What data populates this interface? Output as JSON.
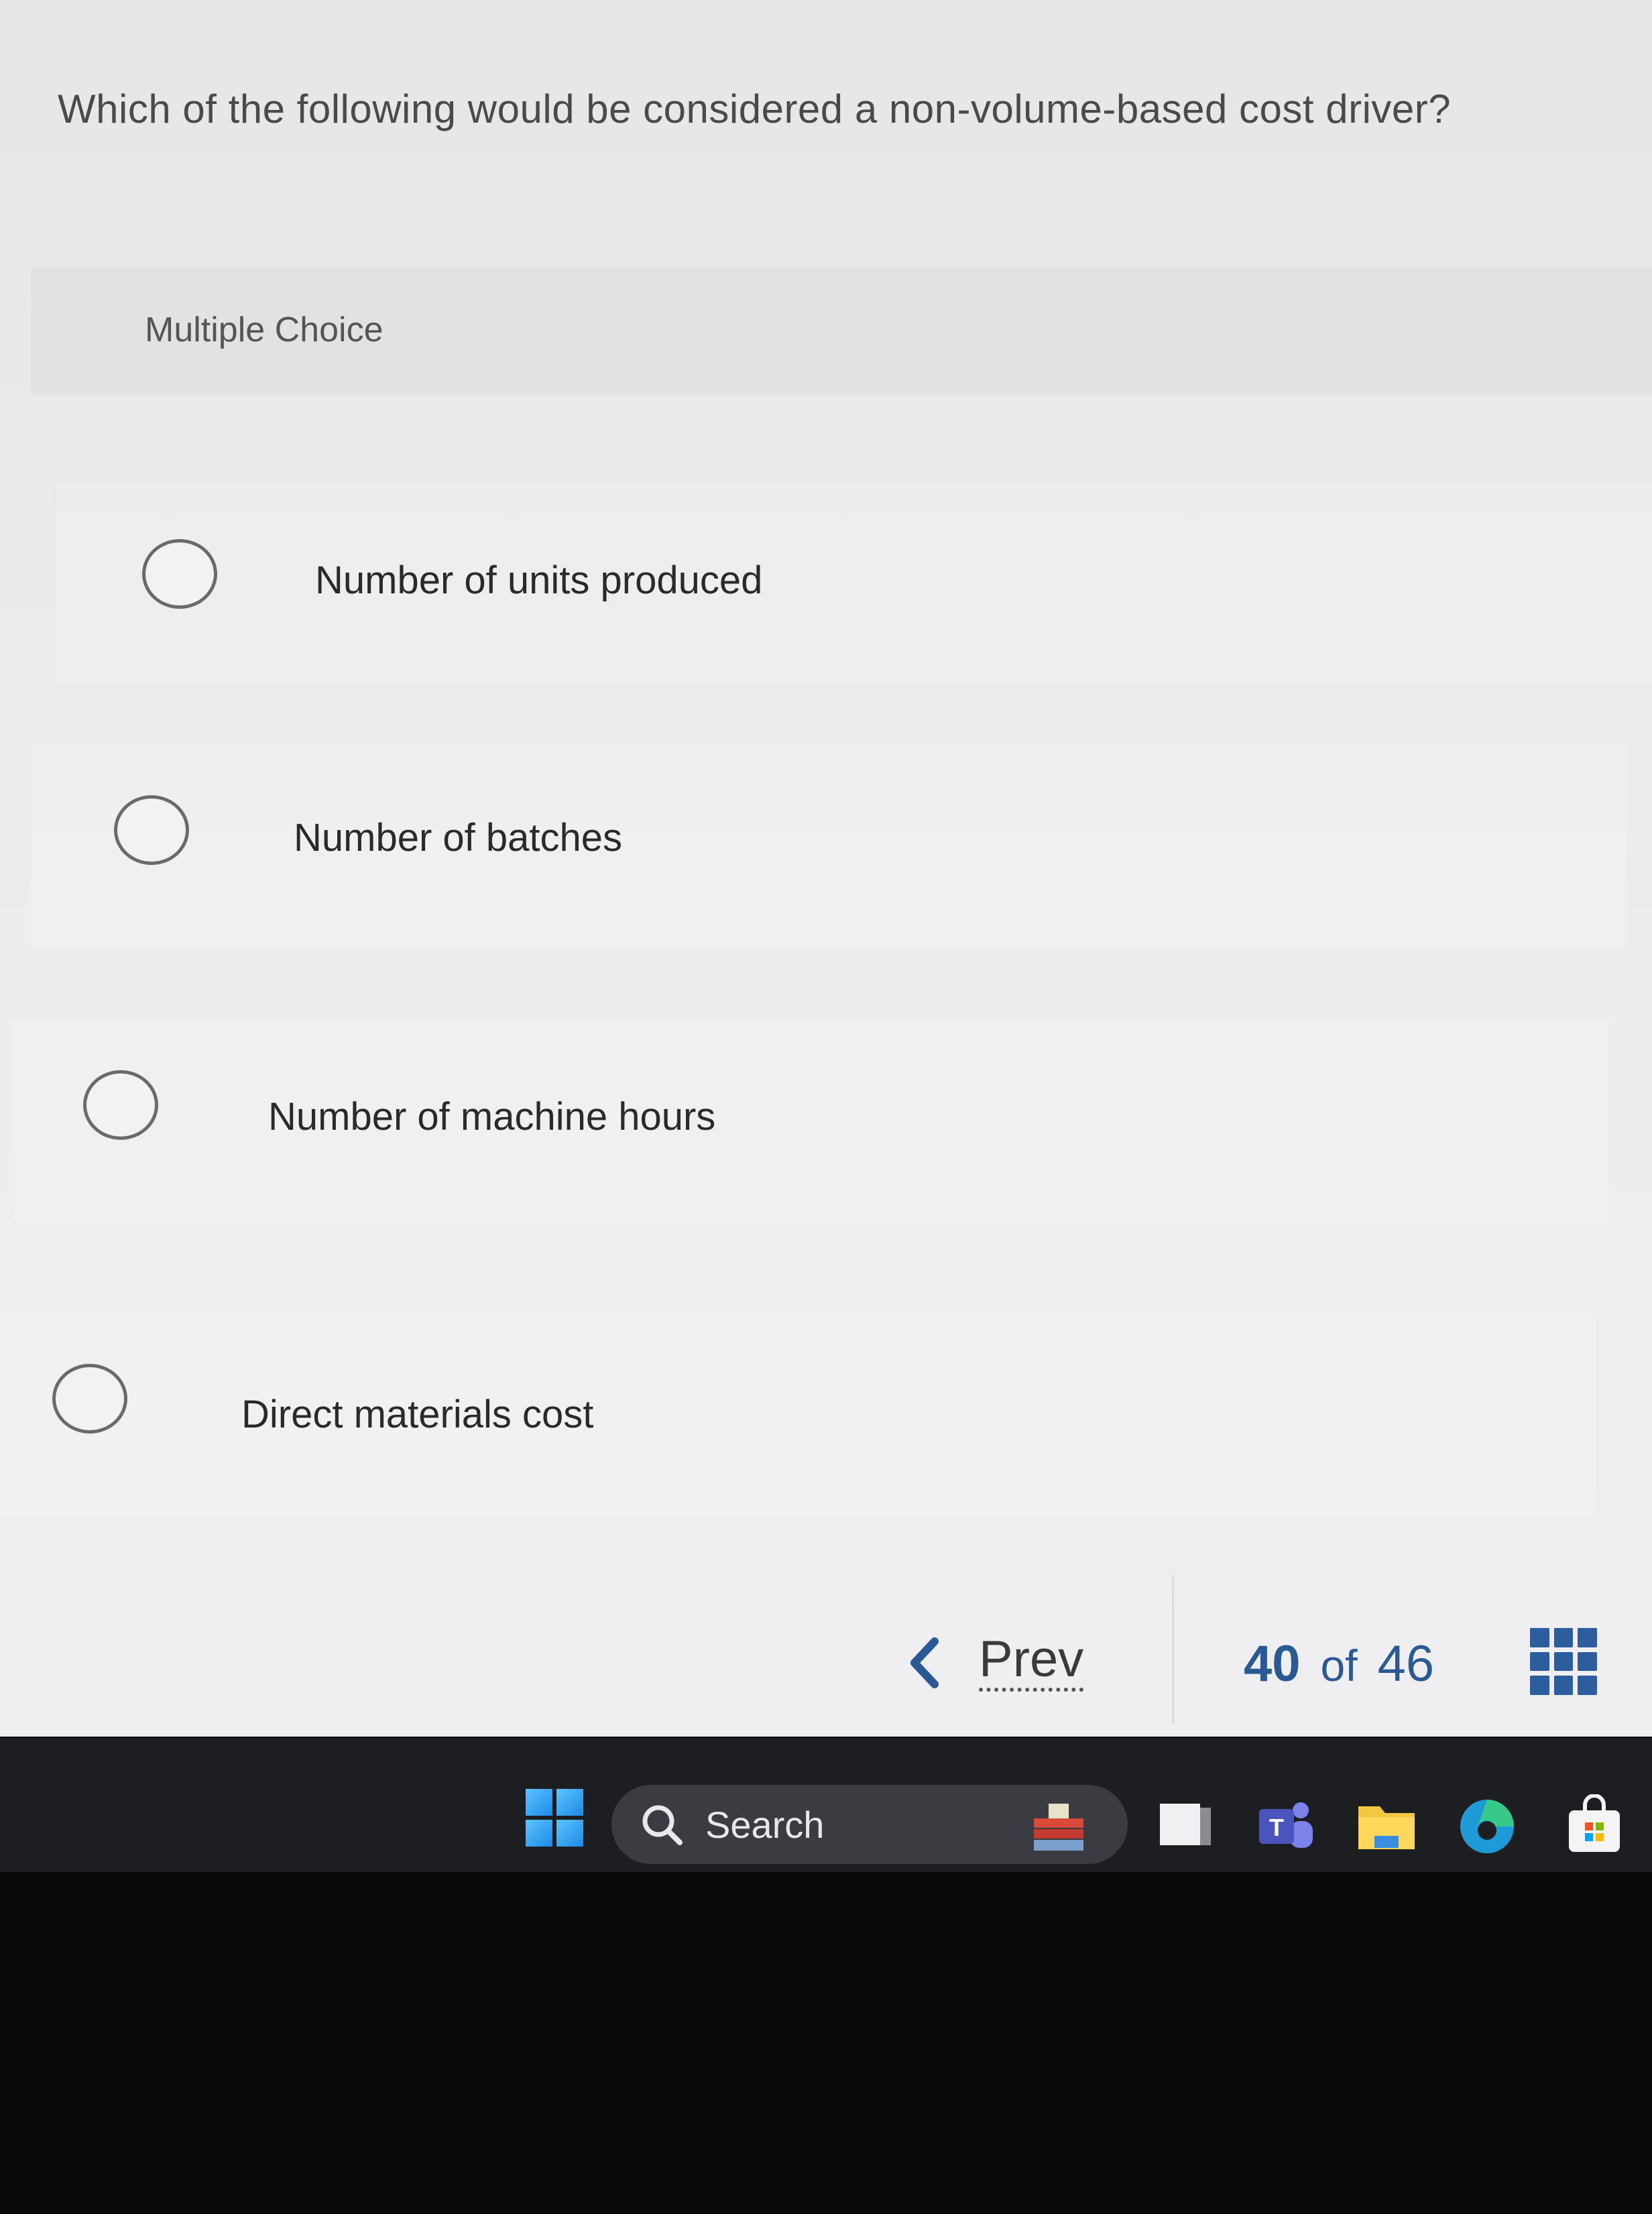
{
  "question": {
    "text": "Which of the following would be considered a non-volume-based cost driver?"
  },
  "section": {
    "label": "Multiple Choice"
  },
  "options": [
    {
      "label": "Number of units produced",
      "selected": false
    },
    {
      "label": "Number of batches",
      "selected": false
    },
    {
      "label": "Number of machine hours",
      "selected": false
    },
    {
      "label": "Direct materials cost",
      "selected": false
    }
  ],
  "navigation": {
    "prev_label": "Prev",
    "current": "40",
    "of_label": "of",
    "total": "46"
  },
  "taskbar": {
    "search_label": "Search",
    "icons": [
      "windows-start-icon",
      "search-icon",
      "task-view-icon",
      "teams-icon",
      "file-explorer-icon",
      "edge-icon",
      "store-icon"
    ]
  },
  "colors": {
    "accent": "#2a5a96",
    "taskbar": "#1c1e22"
  }
}
